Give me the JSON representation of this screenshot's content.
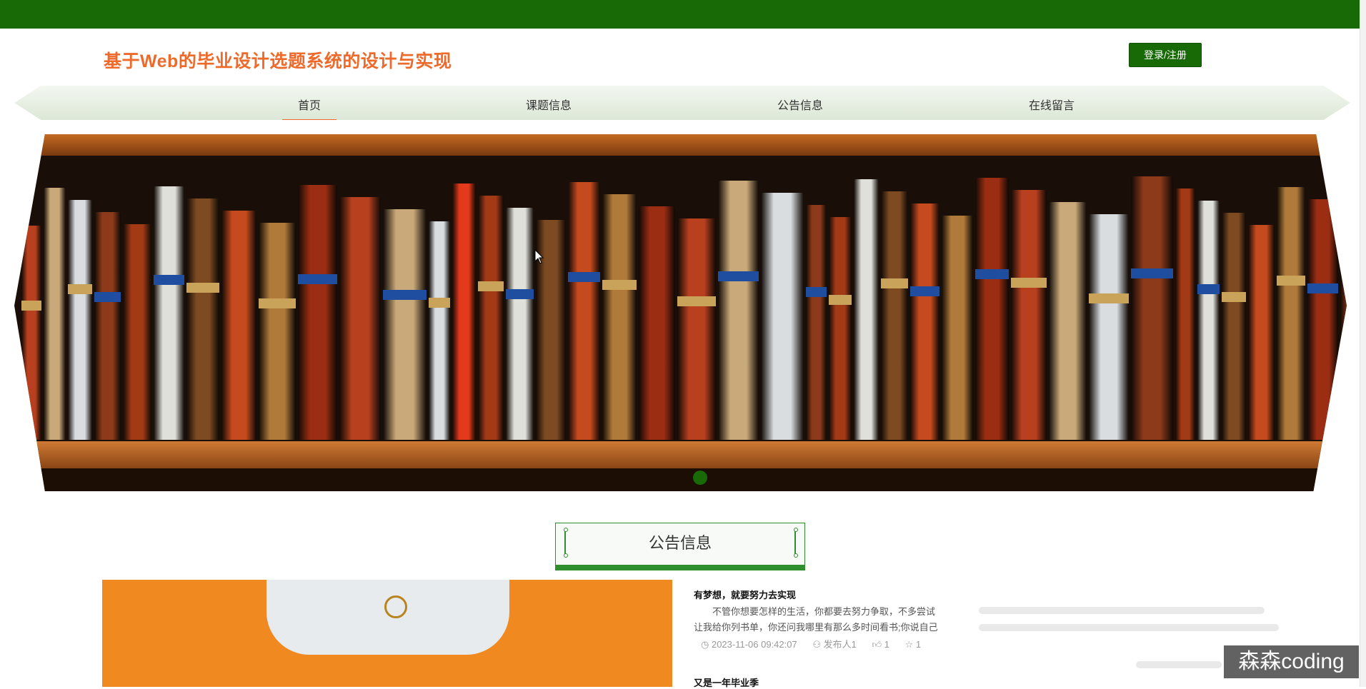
{
  "header": {
    "site_title": "基于Web的毕业设计选题系统的设计与实现",
    "login_label": "登录/注册"
  },
  "nav": {
    "items": [
      "首页",
      "课题信息",
      "公告信息",
      "在线留言"
    ],
    "active": "首页"
  },
  "section": {
    "title": "公告信息"
  },
  "news": [
    {
      "title": "有梦想，就要努力去实现",
      "body_line1": "不管你想要怎样的生活，你都要去努力争取，不多尝试",
      "body_line2": "让我给你列书单，你还问我哪里有那么多时间看书;你说自己",
      "date": "2023-11-06 09:42:07",
      "author": "发布人1",
      "likes": "1",
      "favorites": "1"
    },
    {
      "title": "又是一年毕业季"
    }
  ],
  "watermark": "森森coding",
  "colors": {
    "brand_green": "#176a06",
    "title_orange": "#ee6a2b"
  }
}
